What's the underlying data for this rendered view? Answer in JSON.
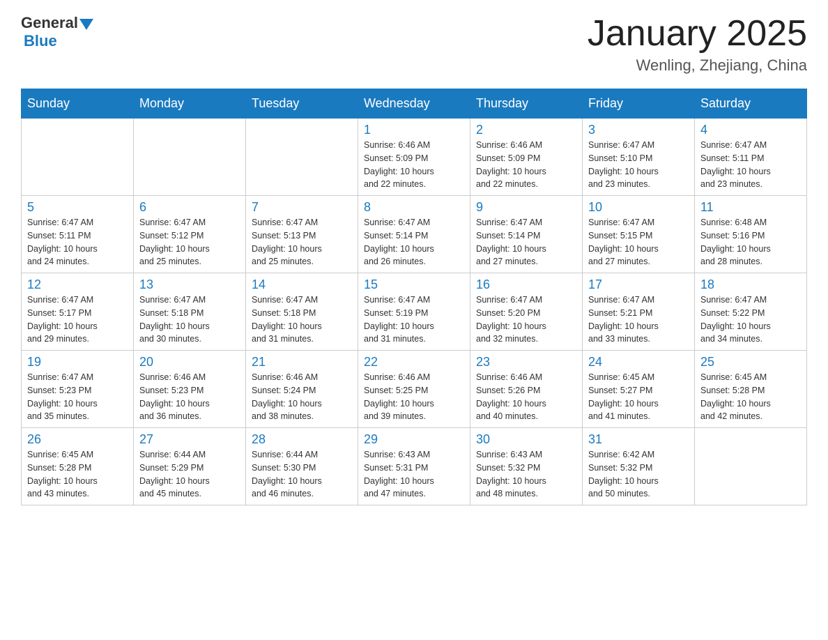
{
  "header": {
    "logo_general": "General",
    "logo_blue": "Blue",
    "month_title": "January 2025",
    "location": "Wenling, Zhejiang, China"
  },
  "days_of_week": [
    "Sunday",
    "Monday",
    "Tuesday",
    "Wednesday",
    "Thursday",
    "Friday",
    "Saturday"
  ],
  "weeks": [
    {
      "days": [
        {
          "number": "",
          "info": ""
        },
        {
          "number": "",
          "info": ""
        },
        {
          "number": "",
          "info": ""
        },
        {
          "number": "1",
          "info": "Sunrise: 6:46 AM\nSunset: 5:09 PM\nDaylight: 10 hours\nand 22 minutes."
        },
        {
          "number": "2",
          "info": "Sunrise: 6:46 AM\nSunset: 5:09 PM\nDaylight: 10 hours\nand 22 minutes."
        },
        {
          "number": "3",
          "info": "Sunrise: 6:47 AM\nSunset: 5:10 PM\nDaylight: 10 hours\nand 23 minutes."
        },
        {
          "number": "4",
          "info": "Sunrise: 6:47 AM\nSunset: 5:11 PM\nDaylight: 10 hours\nand 23 minutes."
        }
      ]
    },
    {
      "days": [
        {
          "number": "5",
          "info": "Sunrise: 6:47 AM\nSunset: 5:11 PM\nDaylight: 10 hours\nand 24 minutes."
        },
        {
          "number": "6",
          "info": "Sunrise: 6:47 AM\nSunset: 5:12 PM\nDaylight: 10 hours\nand 25 minutes."
        },
        {
          "number": "7",
          "info": "Sunrise: 6:47 AM\nSunset: 5:13 PM\nDaylight: 10 hours\nand 25 minutes."
        },
        {
          "number": "8",
          "info": "Sunrise: 6:47 AM\nSunset: 5:14 PM\nDaylight: 10 hours\nand 26 minutes."
        },
        {
          "number": "9",
          "info": "Sunrise: 6:47 AM\nSunset: 5:14 PM\nDaylight: 10 hours\nand 27 minutes."
        },
        {
          "number": "10",
          "info": "Sunrise: 6:47 AM\nSunset: 5:15 PM\nDaylight: 10 hours\nand 27 minutes."
        },
        {
          "number": "11",
          "info": "Sunrise: 6:48 AM\nSunset: 5:16 PM\nDaylight: 10 hours\nand 28 minutes."
        }
      ]
    },
    {
      "days": [
        {
          "number": "12",
          "info": "Sunrise: 6:47 AM\nSunset: 5:17 PM\nDaylight: 10 hours\nand 29 minutes."
        },
        {
          "number": "13",
          "info": "Sunrise: 6:47 AM\nSunset: 5:18 PM\nDaylight: 10 hours\nand 30 minutes."
        },
        {
          "number": "14",
          "info": "Sunrise: 6:47 AM\nSunset: 5:18 PM\nDaylight: 10 hours\nand 31 minutes."
        },
        {
          "number": "15",
          "info": "Sunrise: 6:47 AM\nSunset: 5:19 PM\nDaylight: 10 hours\nand 31 minutes."
        },
        {
          "number": "16",
          "info": "Sunrise: 6:47 AM\nSunset: 5:20 PM\nDaylight: 10 hours\nand 32 minutes."
        },
        {
          "number": "17",
          "info": "Sunrise: 6:47 AM\nSunset: 5:21 PM\nDaylight: 10 hours\nand 33 minutes."
        },
        {
          "number": "18",
          "info": "Sunrise: 6:47 AM\nSunset: 5:22 PM\nDaylight: 10 hours\nand 34 minutes."
        }
      ]
    },
    {
      "days": [
        {
          "number": "19",
          "info": "Sunrise: 6:47 AM\nSunset: 5:23 PM\nDaylight: 10 hours\nand 35 minutes."
        },
        {
          "number": "20",
          "info": "Sunrise: 6:46 AM\nSunset: 5:23 PM\nDaylight: 10 hours\nand 36 minutes."
        },
        {
          "number": "21",
          "info": "Sunrise: 6:46 AM\nSunset: 5:24 PM\nDaylight: 10 hours\nand 38 minutes."
        },
        {
          "number": "22",
          "info": "Sunrise: 6:46 AM\nSunset: 5:25 PM\nDaylight: 10 hours\nand 39 minutes."
        },
        {
          "number": "23",
          "info": "Sunrise: 6:46 AM\nSunset: 5:26 PM\nDaylight: 10 hours\nand 40 minutes."
        },
        {
          "number": "24",
          "info": "Sunrise: 6:45 AM\nSunset: 5:27 PM\nDaylight: 10 hours\nand 41 minutes."
        },
        {
          "number": "25",
          "info": "Sunrise: 6:45 AM\nSunset: 5:28 PM\nDaylight: 10 hours\nand 42 minutes."
        }
      ]
    },
    {
      "days": [
        {
          "number": "26",
          "info": "Sunrise: 6:45 AM\nSunset: 5:28 PM\nDaylight: 10 hours\nand 43 minutes."
        },
        {
          "number": "27",
          "info": "Sunrise: 6:44 AM\nSunset: 5:29 PM\nDaylight: 10 hours\nand 45 minutes."
        },
        {
          "number": "28",
          "info": "Sunrise: 6:44 AM\nSunset: 5:30 PM\nDaylight: 10 hours\nand 46 minutes."
        },
        {
          "number": "29",
          "info": "Sunrise: 6:43 AM\nSunset: 5:31 PM\nDaylight: 10 hours\nand 47 minutes."
        },
        {
          "number": "30",
          "info": "Sunrise: 6:43 AM\nSunset: 5:32 PM\nDaylight: 10 hours\nand 48 minutes."
        },
        {
          "number": "31",
          "info": "Sunrise: 6:42 AM\nSunset: 5:32 PM\nDaylight: 10 hours\nand 50 minutes."
        },
        {
          "number": "",
          "info": ""
        }
      ]
    }
  ]
}
